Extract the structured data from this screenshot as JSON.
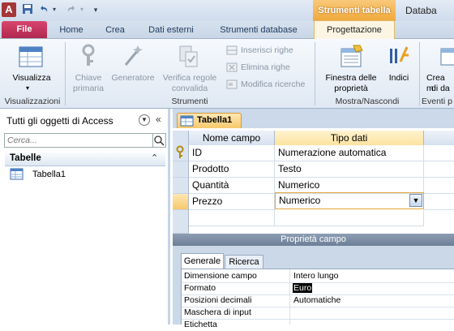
{
  "app": {
    "icon_letter": "A",
    "title": "Databa",
    "context_tools_label": "Strumenti tabella"
  },
  "quick_access": [
    "save-icon",
    "undo-icon",
    "redo-icon",
    "customize-icon"
  ],
  "tabs": {
    "file": "File",
    "home": "Home",
    "crea": "Crea",
    "dati_esterni": "Dati esterni",
    "strumenti_database": "Strumenti database",
    "progettazione": "Progettazione"
  },
  "ribbon": {
    "visualizza": "Visualizza",
    "visualizzazioni": "Visualizzazioni",
    "chiave_primaria": [
      "Chiave",
      "primaria"
    ],
    "generatore": "Generatore",
    "verifica": [
      "Verifica regole",
      "convalida"
    ],
    "inserisci_righe": "Inserisci righe",
    "elimina_righe": "Elimina righe",
    "modifica_ricerche": "Modifica ricerche",
    "strumenti": "Strumenti",
    "finestra_proprieta": [
      "Finestra delle",
      "proprietà"
    ],
    "indici": "Indici",
    "mostra_nascondi": "Mostra/Nascondi",
    "crea_macro": [
      "Crea m",
      "di da"
    ],
    "eventi": "Eventi p"
  },
  "nav": {
    "title": "Tutti gli oggetti di Access",
    "search_placeholder": "Cerca...",
    "group": "Tabelle",
    "item": "Tabella1"
  },
  "document": {
    "tab": "Tabella1",
    "col_nome": "Nome campo",
    "col_tipo": "Tipo dati",
    "rows": [
      {
        "name": "ID",
        "type": "Numerazione automatica"
      },
      {
        "name": "Prodotto",
        "type": "Testo"
      },
      {
        "name": "Quantità",
        "type": "Numerico"
      },
      {
        "name": "Prezzo",
        "type": "Numerico"
      }
    ]
  },
  "properties": {
    "title": "Proprietà campo",
    "tab_generale": "Generale",
    "tab_ricerca": "Ricerca",
    "rows": [
      {
        "label": "Dimensione campo",
        "value": "Intero lungo"
      },
      {
        "label": "Formato",
        "value": "Euro"
      },
      {
        "label": "Posizioni decimali",
        "value": "Automatiche"
      },
      {
        "label": "Maschera di input",
        "value": ""
      },
      {
        "label": "Etichetta",
        "value": ""
      }
    ]
  },
  "colors": {
    "file_tab": "#b0284f",
    "context_tab": "#f0a83a",
    "selection_highlight": "#000000"
  }
}
